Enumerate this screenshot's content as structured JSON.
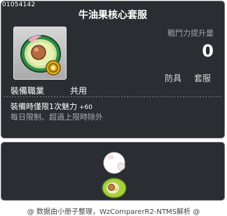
{
  "item": {
    "id": "01054142",
    "name": "牛油果核心套服",
    "stat_label": "戰鬥力提升量",
    "stat_value": "0",
    "tags": [
      "防具",
      "套服"
    ],
    "job_label": "裝備職業",
    "job_value": "共用",
    "effect": "裝備時僅限1次魅力",
    "effect_bonus": "+60",
    "limit": "每日限制、超過上限時除外"
  },
  "footer": {
    "text": "@ 数据由小册子整理，WzComparerR2-NTMS解析 @"
  },
  "icons": {
    "item": "avocado-coin-icon",
    "preview": "avocado-costume-preview"
  }
}
